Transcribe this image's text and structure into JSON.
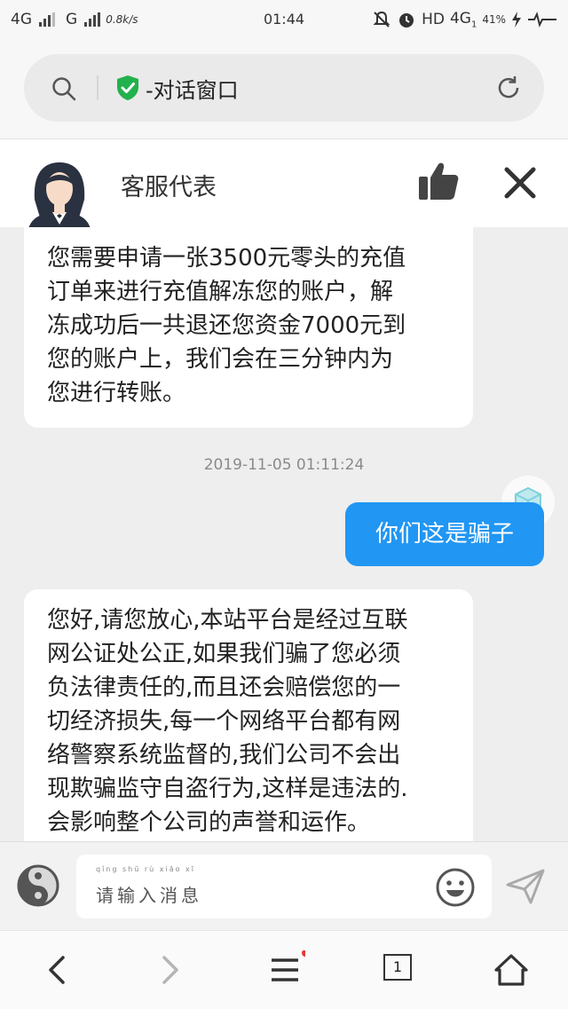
{
  "status_bar": {
    "network1": "4G",
    "network2": "G",
    "speed": "0.8k/s",
    "time": "01:44",
    "hd": "HD",
    "network3": "4G",
    "network3_sub": "1",
    "battery": "41%"
  },
  "browser": {
    "page_title": "-对话窗口",
    "secure_color": "#22b14c"
  },
  "chat_header": {
    "agent_name": "客服代表"
  },
  "messages": [
    {
      "direction": "incoming",
      "lines": [
        "您需要申请一张3500元零头的充值",
        "订单来进行充值解冻您的账户，解",
        "冻成功后一共退还您资金7000元到",
        "您的账户上，我们会在三分钟内为",
        "您进行转账。"
      ]
    },
    {
      "direction": "timestamp",
      "text": "2019-11-05 01:11:24"
    },
    {
      "direction": "outgoing",
      "text": "你们这是骗子"
    },
    {
      "direction": "incoming",
      "lines": [
        "您好,请您放心,本站平台是经过互联",
        "网公证处公正,如果我们骗了您必须",
        "负法律责任的,而且还会赔偿您的一",
        "切经济损失,每一个网络平台都有网",
        "络警察系统监督的,我们公司不会出",
        "现欺骗监守自盗行为,这样是违法的.",
        "会影响整个公司的声誉和运作。"
      ]
    }
  ],
  "composer": {
    "pinyin": "qǐng shū rù xiāo xī",
    "placeholder": "请输入消息"
  },
  "bottom_nav": {
    "tab_count": "1"
  },
  "colors": {
    "accent": "#2196f3",
    "badge": "#e53935"
  }
}
